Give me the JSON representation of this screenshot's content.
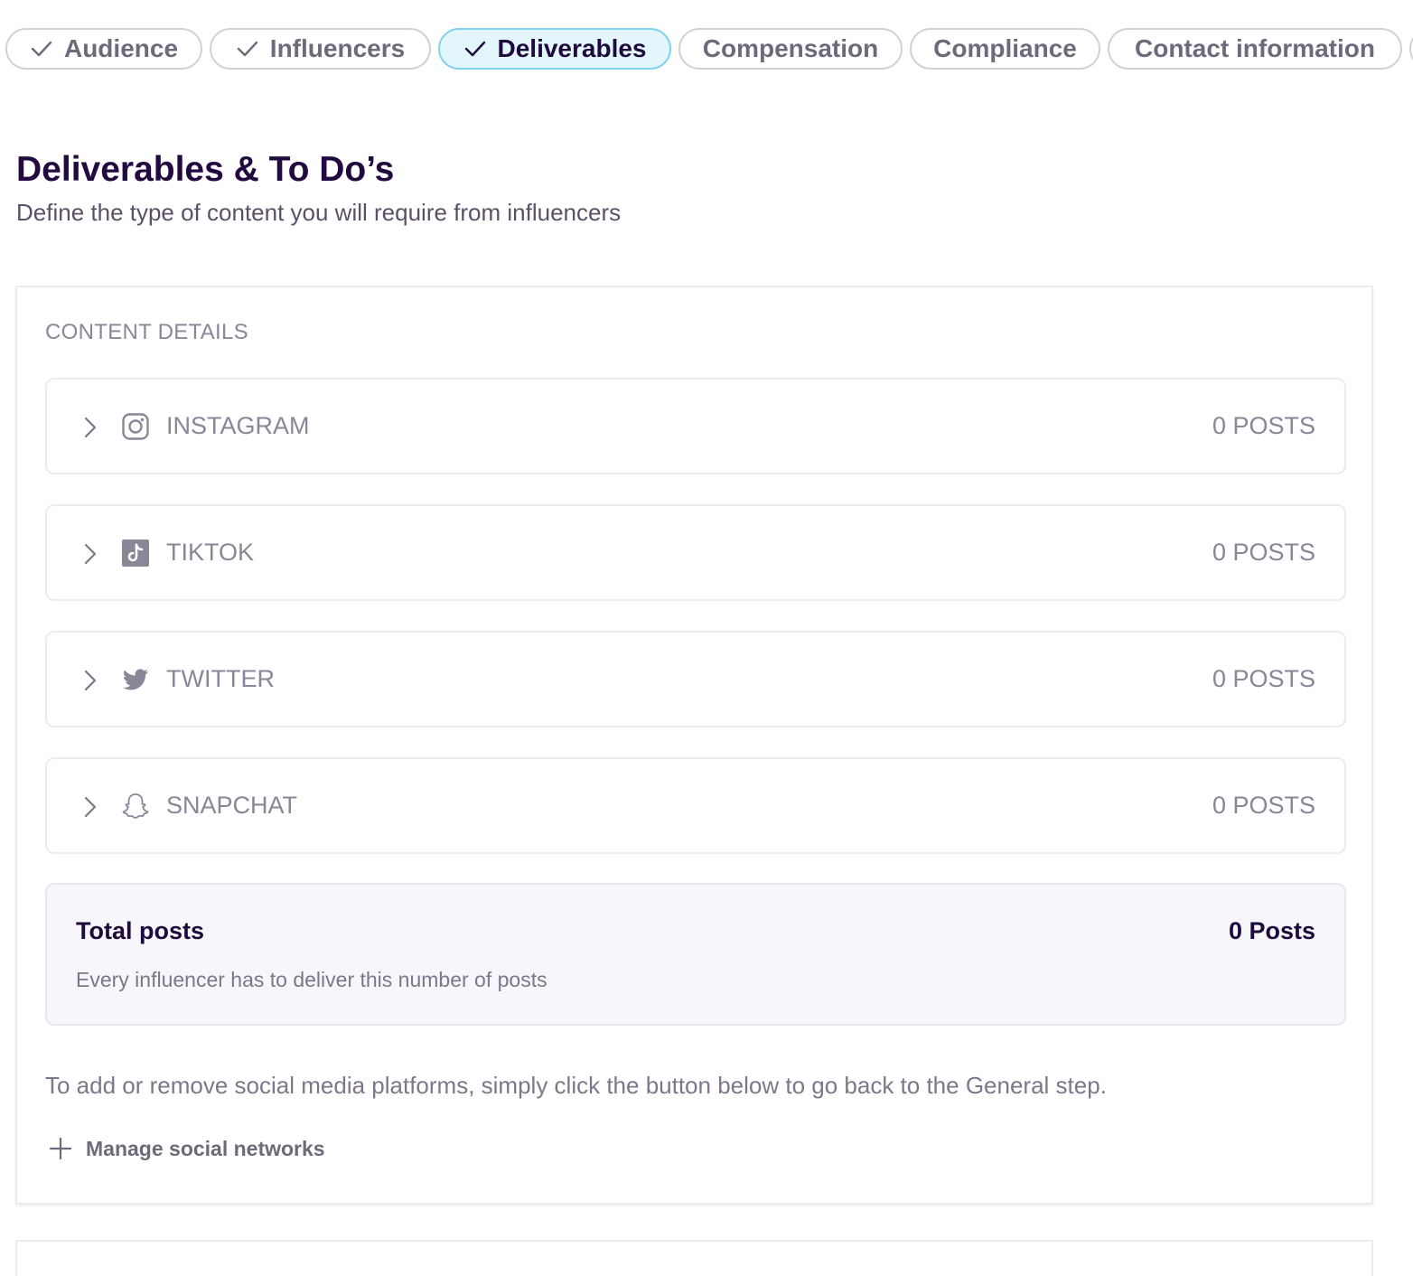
{
  "steps": [
    {
      "label": "Audience",
      "checked": true,
      "active": false
    },
    {
      "label": "Influencers",
      "checked": true,
      "active": false
    },
    {
      "label": "Deliverables",
      "checked": true,
      "active": true
    },
    {
      "label": "Compensation",
      "checked": false,
      "active": false
    },
    {
      "label": "Compliance",
      "checked": false,
      "active": false
    },
    {
      "label": "Contact information",
      "checked": false,
      "active": false
    }
  ],
  "page": {
    "title": "Deliverables & To Do’s",
    "subtitle": "Define the type of content you will require from influencers"
  },
  "content": {
    "section_label": "CONTENT DETAILS",
    "platforms": [
      {
        "name": "INSTAGRAM",
        "count": "0 POSTS",
        "icon": "instagram-icon"
      },
      {
        "name": "TIKTOK",
        "count": "0 POSTS",
        "icon": "tiktok-icon"
      },
      {
        "name": "TWITTER",
        "count": "0 POSTS",
        "icon": "twitter-icon"
      },
      {
        "name": "SNAPCHAT",
        "count": "0 POSTS",
        "icon": "snapchat-icon"
      }
    ],
    "total": {
      "label": "Total posts",
      "value": "0 Posts",
      "note": "Every influencer has to deliver this number of posts"
    },
    "help_text": "To add or remove social media platforms, simply click the button below to go back to the General step.",
    "manage_label": "Manage social networks"
  },
  "colors": {
    "active_step_bg": "#e2f6fc",
    "active_step_border": "#7fd3ee",
    "heading": "#22093f",
    "muted": "#8b8598"
  }
}
